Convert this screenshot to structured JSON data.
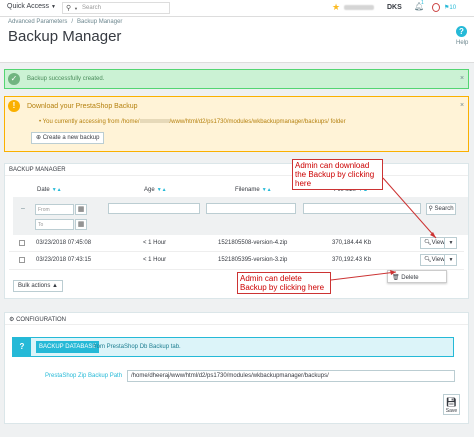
{
  "topbar": {
    "quick_access": "Quick Access",
    "search_placeholder": "Search",
    "shop_name": "DKS",
    "notif_count": "1",
    "orders_count": "10"
  },
  "header": {
    "breadcrumb": [
      "Advanced Parameters",
      "Backup Manager"
    ],
    "title": "Backup Manager",
    "help_label": "Help"
  },
  "success_alert": {
    "text": "Backup successfully created."
  },
  "warning_alert": {
    "title": "Download your PrestaShop Backup",
    "line_prefix": "You currently accessing from /home/",
    "line_suffix": "/www/html/d2/ps1730/modules/wkbackupmanager/backups/ folder",
    "create_button": "Create a new backup"
  },
  "backup_panel": {
    "heading": "BACKUP MANAGER",
    "columns": [
      "Date",
      "Age",
      "Filename",
      "File size"
    ],
    "filter": {
      "from_placeholder": "From",
      "to_placeholder": "To",
      "search_button": "Search"
    },
    "rows": [
      {
        "date": "03/23/2018 07:45:08",
        "age": "< 1 Hour",
        "filename": "1521805508-version-4.zip",
        "size": "370,184.44 Kb",
        "action": "View"
      },
      {
        "date": "03/23/2018 07:43:15",
        "age": "< 1 Hour",
        "filename": "1521805395-version-3.zip",
        "size": "370,192.43 Kb",
        "action": "View"
      }
    ],
    "dropdown_item": "Delete",
    "bulk_actions": "Bulk actions"
  },
  "annotations": {
    "download_note": "Admin can download the Backup by clicking here",
    "delete_note": "Admin can delete Backup by clicking here"
  },
  "config_panel": {
    "heading": "CONFIGURATION",
    "backup_db_button": "BACKUP DATABASE",
    "info_text": "from PrestaShop Db Backup tab.",
    "zip_path_label": "PrestaShop Zip Backup Path",
    "zip_path_value": "/home/dheeraj/www/html/d2/ps1730/modules/wkbackupmanager/backups/",
    "save_label": "Save"
  }
}
